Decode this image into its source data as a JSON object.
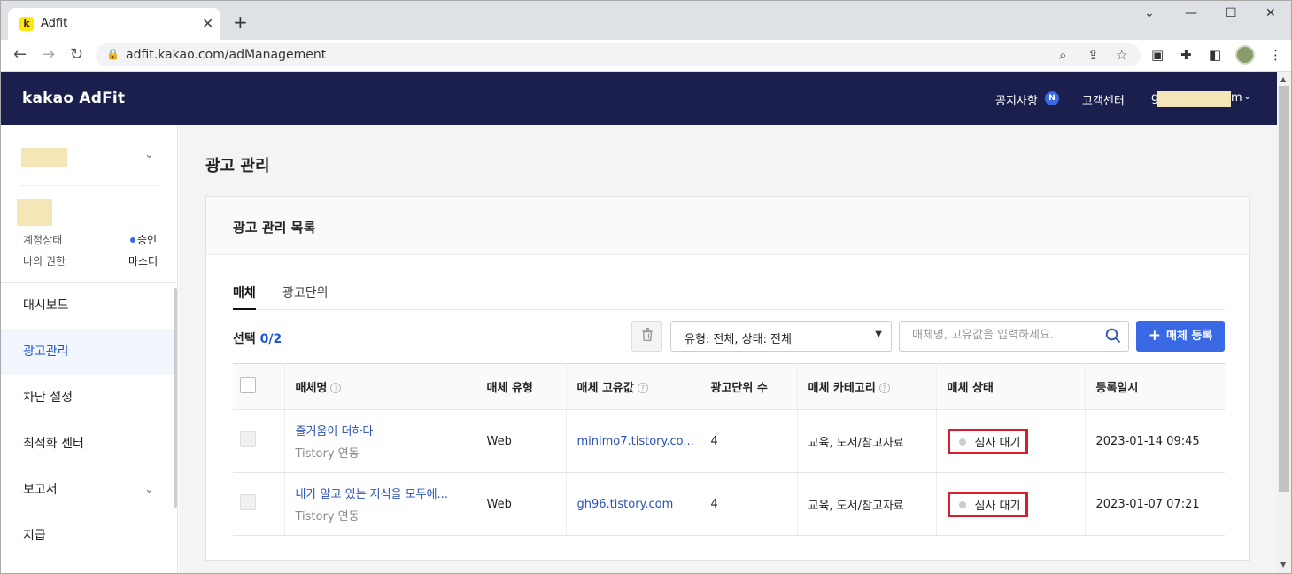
{
  "browser": {
    "tab_title": "Adfit",
    "favicon_letter": "k",
    "url": "adfit.kakao.com/adManagement"
  },
  "header": {
    "logo": "kakao AdFit",
    "notice": "공지사항",
    "notice_badge": "N",
    "support": "고객센터",
    "account_prefix": "g",
    "account_suffix": "m"
  },
  "sidebar": {
    "account_status_label": "계정상태",
    "account_status_value": "승인",
    "role_label": "나의 권한",
    "role_value": "마스터",
    "items": [
      {
        "label": "대시보드",
        "active": false
      },
      {
        "label": "광고관리",
        "active": true
      },
      {
        "label": "차단 설정",
        "active": false
      },
      {
        "label": "최적화 센터",
        "active": false
      },
      {
        "label": "보고서",
        "active": false
      },
      {
        "label": "지급",
        "active": false
      }
    ]
  },
  "main": {
    "page_title": "광고 관리",
    "panel_title": "광고 관리 목록",
    "tabs": [
      "매체",
      "광고단위"
    ],
    "selected_label": "선택",
    "selected_count": "0/2",
    "filter_value": "유형: 전체, 상태: 전체",
    "search_placeholder": "매체명, 고유값을 입력하세요.",
    "register_button": "매체 등록",
    "columns": [
      "매체명",
      "매체 유형",
      "매체 고유값",
      "광고단위 수",
      "매체 카테고리",
      "매체 상태",
      "등록일시"
    ],
    "rows": [
      {
        "name": "즐거움이 더하다",
        "sub": "Tistory 연동",
        "type": "Web",
        "id": "minimo7.tistory.co...",
        "units": "4",
        "category": "교육, 도서/참고자료",
        "status": "심사 대기",
        "date": "2023-01-14 09:45"
      },
      {
        "name": "내가 알고 있는 지식을 모두에...",
        "sub": "Tistory 연동",
        "type": "Web",
        "id": "gh96.tistory.com",
        "units": "4",
        "category": "교육, 도서/참고자료",
        "status": "심사 대기",
        "date": "2023-01-07 07:21"
      }
    ]
  },
  "colors": {
    "header_bg": "#1a1f4e",
    "accent": "#3a69e6",
    "highlight_box": "#d81e2a"
  }
}
